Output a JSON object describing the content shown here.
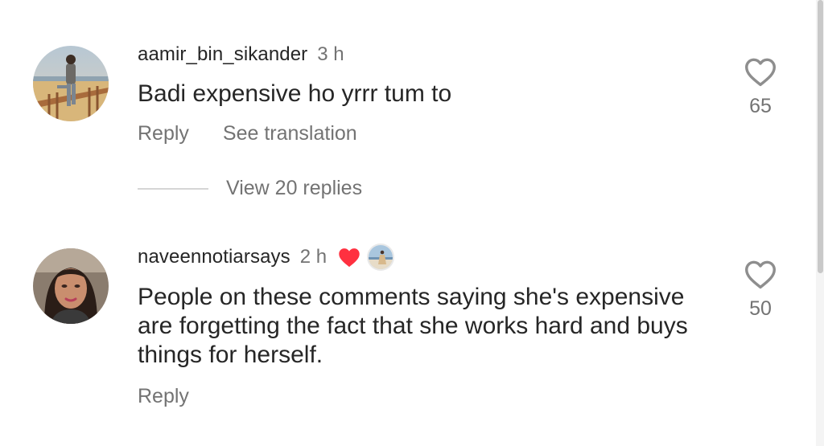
{
  "comments": [
    {
      "username": "aamir_bin_sikander",
      "time": "3 h",
      "text": "Badi expensive ho yrrr tum to",
      "likes": "65",
      "reply_label": "Reply",
      "translate_label": "See translation",
      "view_replies_label": "View 20 replies"
    },
    {
      "username": "naveennotiarsays",
      "time": "2 h",
      "text": "People on these comments saying she's expensive are forgetting the fact that she works hard and buys things for herself.",
      "likes": "50",
      "reply_label": "Reply",
      "creator_liked": true
    }
  ],
  "colors": {
    "primary_text": "#262626",
    "secondary_text": "#737373",
    "heart_red": "#ff3040"
  },
  "icons": {
    "like": "heart-outline-icon",
    "creator_like": "heart-filled-icon"
  }
}
